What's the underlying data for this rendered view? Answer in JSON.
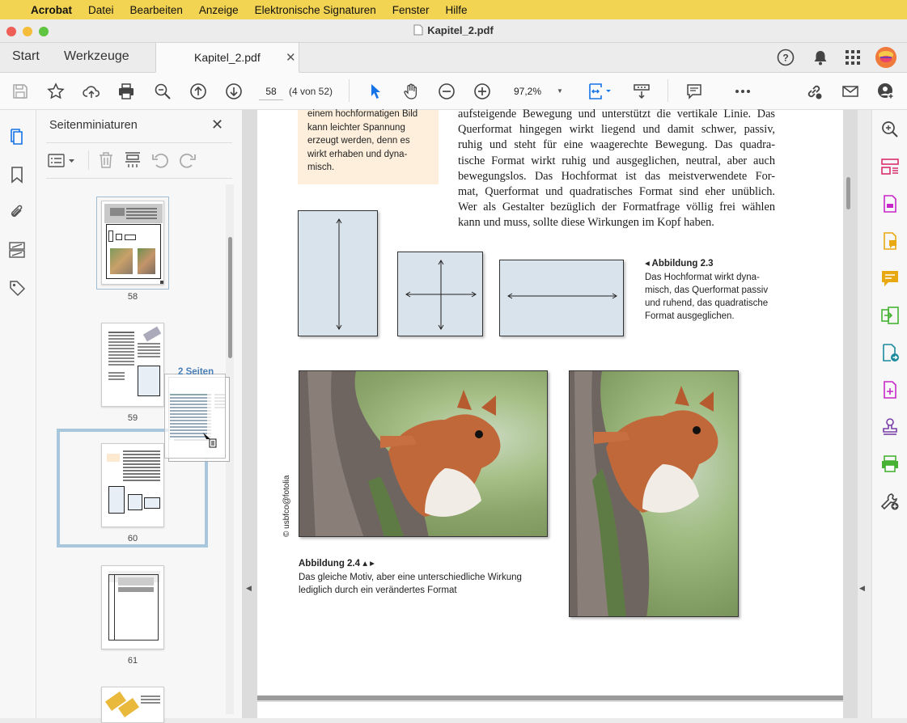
{
  "menubar": {
    "app": "Acrobat",
    "items": [
      "Datei",
      "Bearbeiten",
      "Anzeige",
      "Elektronische Signaturen",
      "Fenster",
      "Hilfe"
    ]
  },
  "window": {
    "title": "Kapitel_2.pdf"
  },
  "tabs": {
    "start": "Start",
    "tools": "Werkzeuge",
    "file": "Kapitel_2.pdf"
  },
  "toolbar": {
    "page_number": "58",
    "page_of": "(4 von 52)",
    "zoom": "97,2%"
  },
  "panel": {
    "title": "Seitenminiaturen",
    "thumbnails": [
      "58",
      "59",
      "60",
      "61"
    ],
    "drag_badge": "2 Seiten"
  },
  "document": {
    "sidebox_text": "einem hochformatigen Bild kann leichter Spannung erzeugt werden, denn es wirkt erhaben und dyna-misch.",
    "paragraph_lines": [
      "aufsteigende Bewegung und unterstützt die vertikale Linie. Das",
      "Querformat hingegen wirkt liegend und damit schwer, passiv,",
      "ruhig und steht für eine waagerechte Bewegung. Das quadra-",
      "tische Format wirkt ruhig und ausgeglichen, neutral, aber auch",
      "bewegungslos. Das Hochformat ist das meistverwendete For-",
      "mat, Querformat und quadratisches Format sind eher unüblich.",
      "Wer als Gestalter bezüglich der Formatfrage völlig frei wählen",
      "kann und muss, sollte diese Wirkungen im Kopf haben."
    ],
    "fig23_title": "◂ Abbildung 2.3",
    "fig23_lines": [
      "Das Hochformat wirkt dyna-",
      "misch, das Querformat passiv",
      "und ruhend, das quadratische",
      "Format ausgeglichen."
    ],
    "photo_credit": "© usbfco@fotolia",
    "fig24_title": "Abbildung 2.4 ▴ ▸",
    "fig24_lines": [
      "Das gleiche Motiv, aber eine unterschiedliche Wirkung",
      "lediglich durch ein verändertes Format"
    ]
  },
  "colors": {
    "menubar": "#f3d452",
    "accent_blue": "#1473e6",
    "selection": "#a9c7dc",
    "figure_fill": "#d9e3ec",
    "sidebox": "#fdefdc",
    "rightrail_magenta": "#c926c9"
  }
}
